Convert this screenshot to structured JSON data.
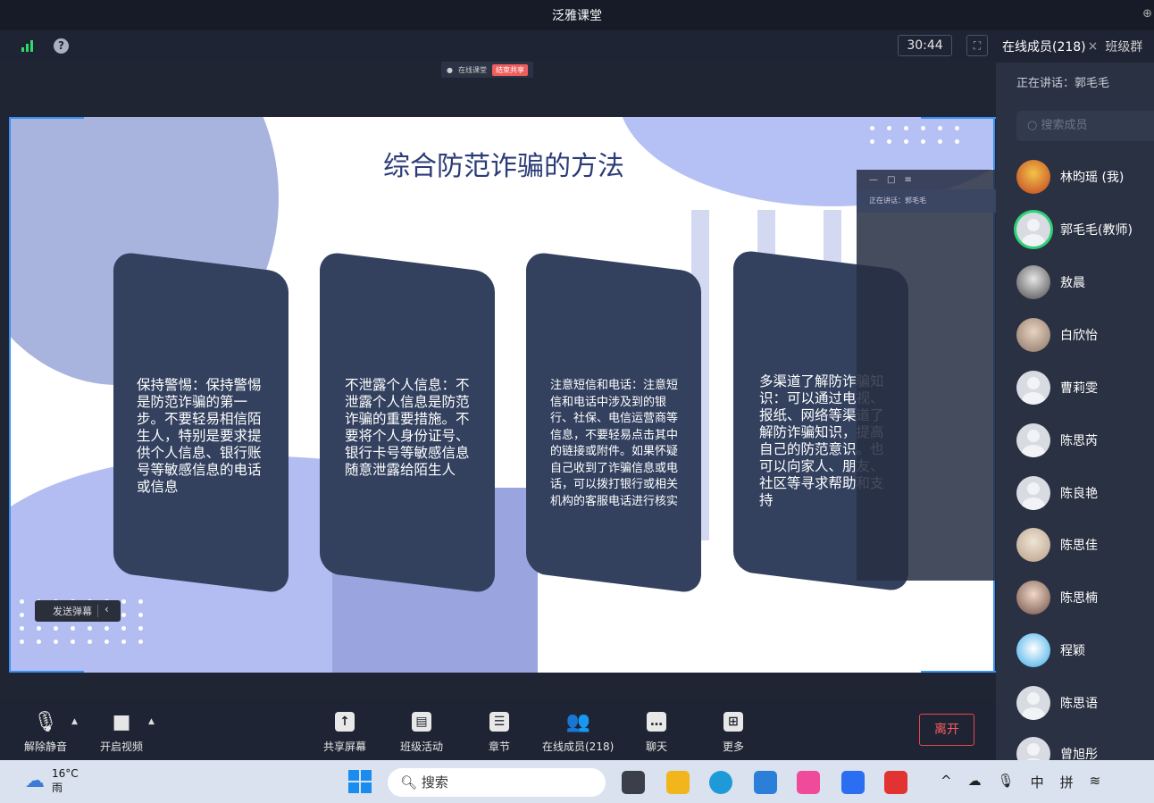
{
  "window": {
    "title": "泛雅课堂"
  },
  "topbar": {
    "timer": "30:44"
  },
  "share_tag": {
    "label": "在线课堂",
    "end_label": "结束共享"
  },
  "slide": {
    "title": "综合防范诈骗的方法",
    "cards": [
      "保持警惕：保持警惕是防范诈骗的第一步。不要轻易相信陌生人，特别是要求提供个人信息、银行账号等敏感信息的电话或信息",
      "不泄露个人信息：不泄露个人信息是防范诈骗的重要措施。不要将个人身份证号、银行卡号等敏感信息随意泄露给陌生人",
      "注意短信和电话：注意短信和电话中涉及到的银行、社保、电信运营商等信息，不要轻易点击其中的链接或附件。如果怀疑自己收到了诈骗信息或电话，可以拨打银行或相关机构的客服电话进行核实",
      "多渠道了解防诈骗知识：可以通过电视、报纸、网络等渠道了解防诈骗知识，提高自己的防范意识。也可以向家人、朋友、社区等寻求帮助和支持"
    ]
  },
  "danmu": {
    "label": "发送弹幕"
  },
  "mini_window": {
    "speaking": "正在讲话：郭毛毛"
  },
  "toolbar": {
    "unmute": "解除静音",
    "video": "开启视频",
    "share": "共享屏幕",
    "activity": "班级活动",
    "chapters": "章节",
    "members": "在线成员(218)",
    "chat": "聊天",
    "more": "更多",
    "leave": "离开"
  },
  "sidebar": {
    "tab_members": "在线成员(218)",
    "tab_group": "班级群",
    "speaking": "正在讲话：郭毛毛",
    "search_placeholder": "搜索成员",
    "members": [
      "林昀瑶 (我)",
      "郭毛毛(教师)",
      "敖晨",
      "白欣怡",
      "曹莉雯",
      "陈思芮",
      "陈良艳",
      "陈思佳",
      "陈思楠",
      "程颖",
      "陈思语",
      "曾旭彤"
    ]
  },
  "taskbar": {
    "temperature": "16°C",
    "weather": "雨",
    "search": "搜索",
    "ime_lang": "中",
    "ime_mode": "拼"
  },
  "colors": {
    "accent": "#3a8ff0",
    "leave": "#e9474e",
    "card": "#33415f",
    "title": "#2b3b78"
  }
}
